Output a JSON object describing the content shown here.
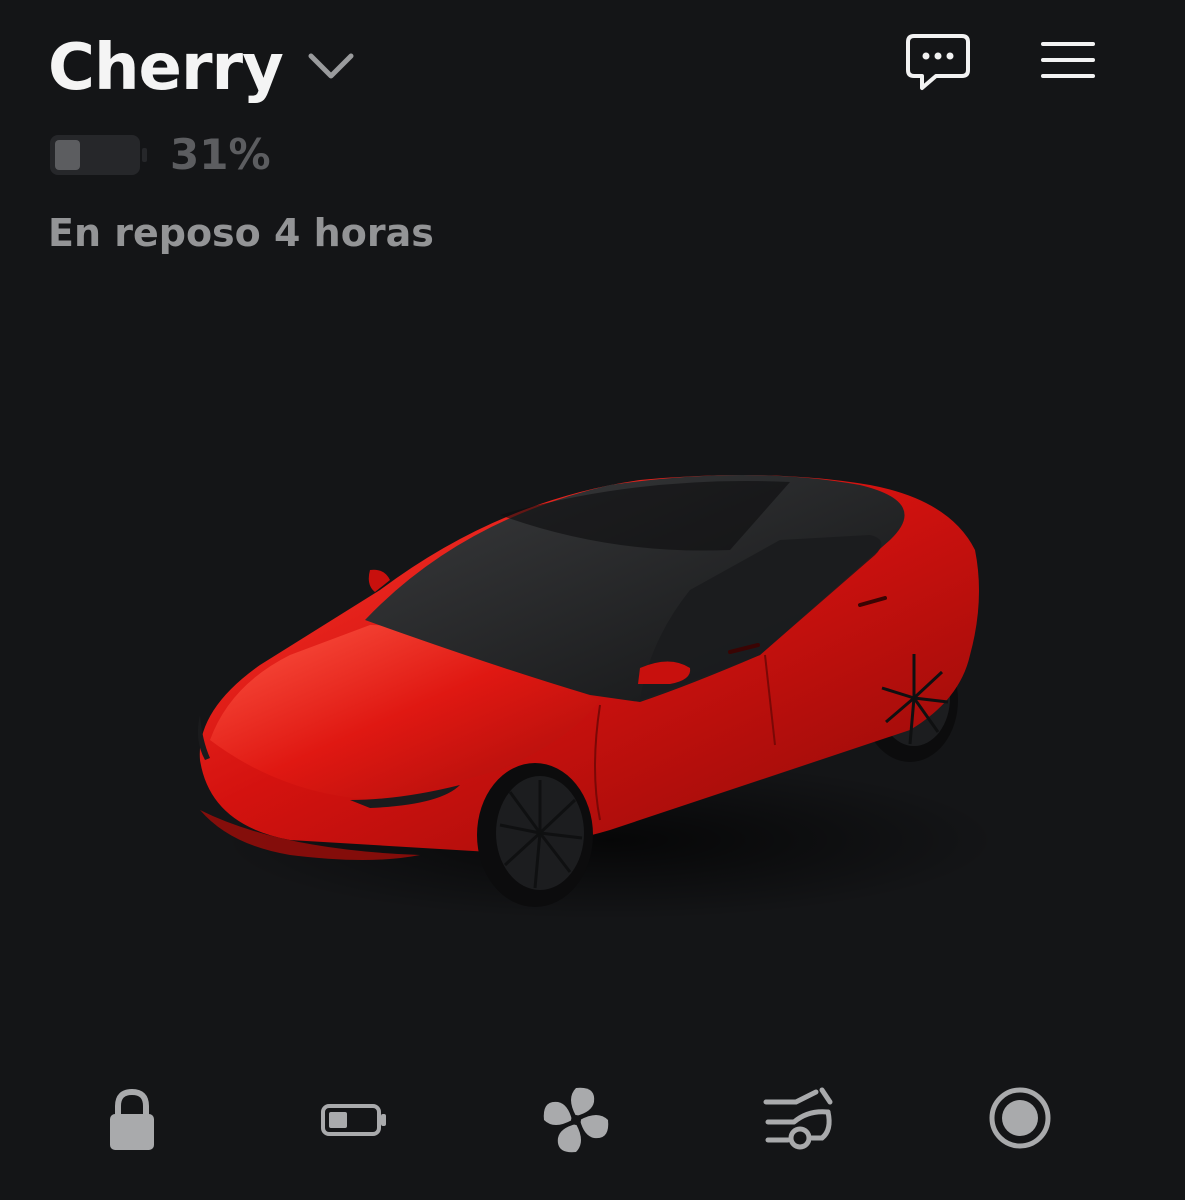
{
  "header": {
    "vehicle_name": "Cherry",
    "messages_icon": "chat-bubble-icon",
    "menu_icon": "hamburger-menu-icon"
  },
  "battery": {
    "percent_label": "31%",
    "level": 0.31
  },
  "status": {
    "text": "En reposo 4 horas"
  },
  "vehicle_image": {
    "color": "#d4120f"
  },
  "bottom_controls": [
    {
      "name": "lock",
      "icon": "lock-icon"
    },
    {
      "name": "charging",
      "icon": "battery-icon"
    },
    {
      "name": "climate",
      "icon": "fan-icon"
    },
    {
      "name": "trunk",
      "icon": "trunk-icon"
    },
    {
      "name": "sentry",
      "icon": "record-circle-icon"
    }
  ],
  "colors": {
    "background": "#141517",
    "title": "#f4f4f4",
    "muted": "#939496",
    "icon": "#a9aaac"
  }
}
